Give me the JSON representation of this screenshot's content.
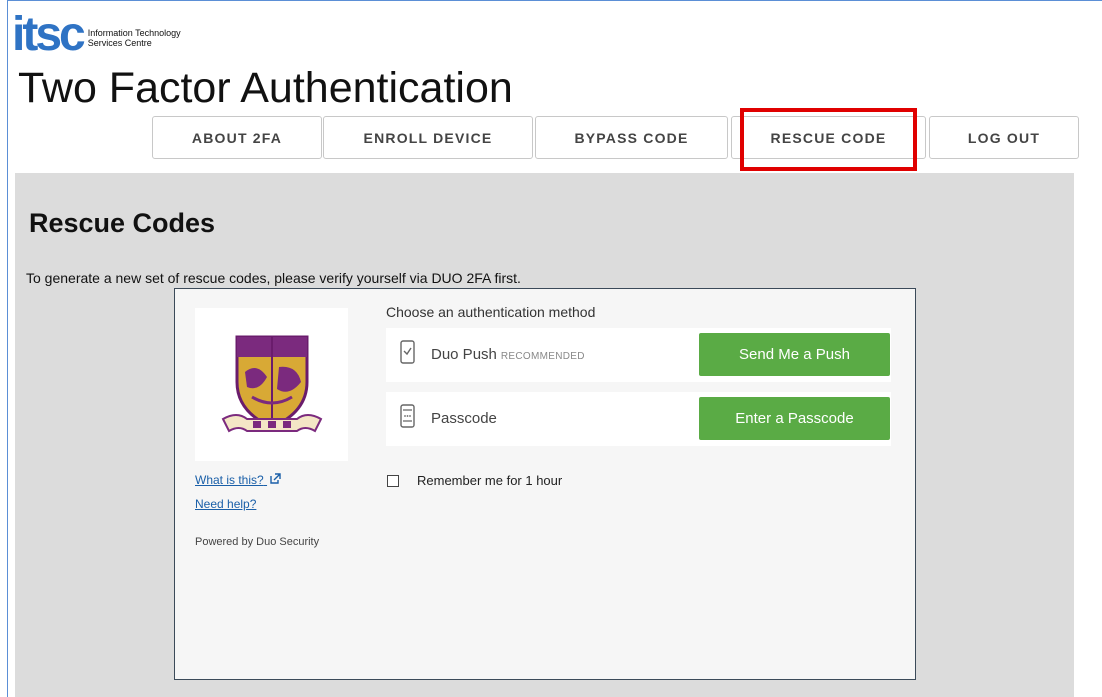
{
  "brand": {
    "logo_text": "itsc",
    "org_line1": "Information Technology",
    "org_line2": "Services Centre",
    "page_title": "Two Factor Authentication"
  },
  "nav": {
    "tabs": [
      {
        "label": "ABOUT 2FA"
      },
      {
        "label": "ENROLL DEVICE"
      },
      {
        "label": "BYPASS CODE"
      },
      {
        "label": "RESCUE CODE",
        "highlighted": true
      },
      {
        "label": "LOG OUT"
      }
    ],
    "highlight_color": "#e00000"
  },
  "section": {
    "title": "Rescue Codes",
    "intro": "To generate a new set of rescue codes, please verify yourself via DUO 2FA first."
  },
  "duo": {
    "logo_icon": "university-crest-icon",
    "what_is_this": "What is this?",
    "need_help": "Need help?",
    "powered_by": "Powered by Duo Security",
    "choose_label": "Choose an authentication method",
    "methods": [
      {
        "label": "Duo Push",
        "tag": "RECOMMENDED",
        "icon": "phone-check-icon",
        "button": "Send Me a Push"
      },
      {
        "label": "Passcode",
        "tag": "",
        "icon": "phone-keypad-icon",
        "button": "Enter a Passcode"
      }
    ],
    "remember_label": "Remember me for 1 hour",
    "button_color": "#5aab45"
  }
}
